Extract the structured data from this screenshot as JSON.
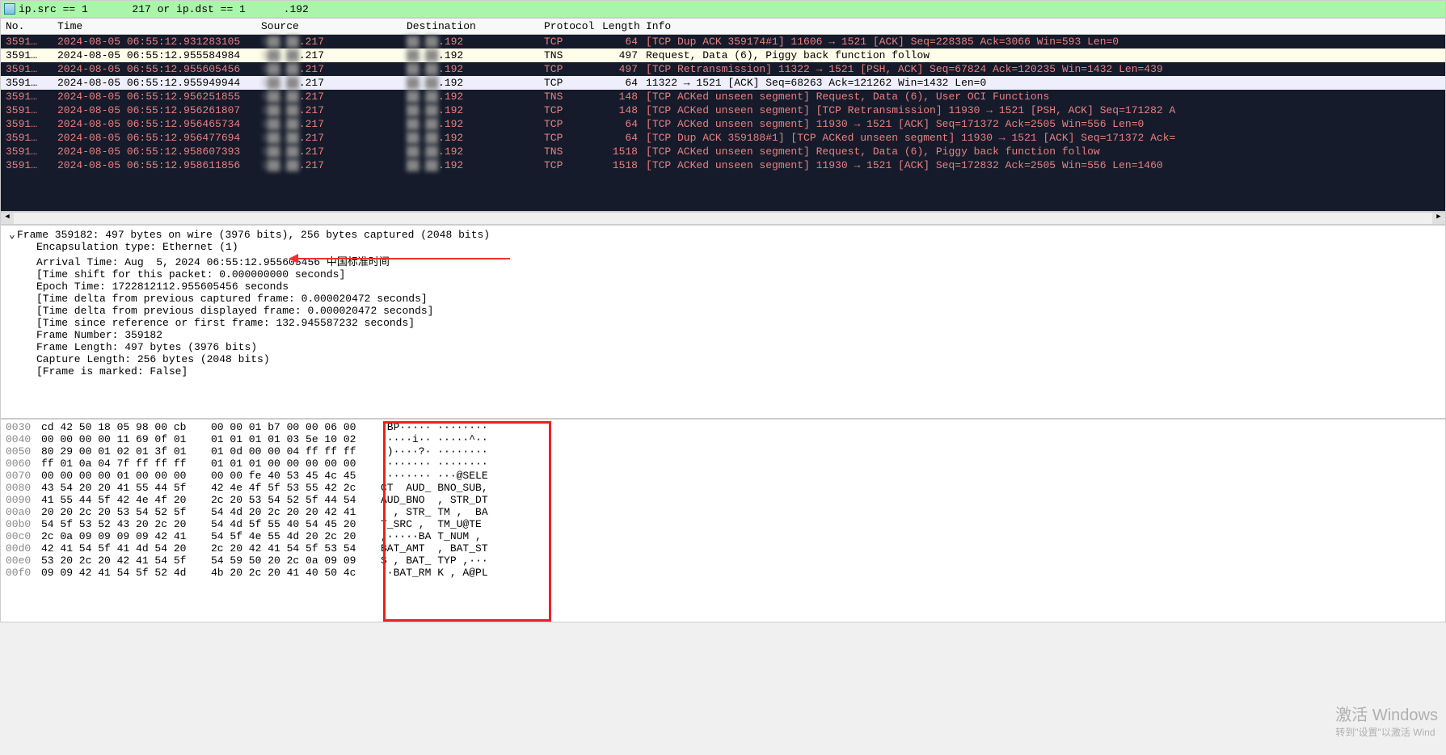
{
  "filter": {
    "value": "ip.src == 1       217 or ip.dst == 1      .192"
  },
  "headers": {
    "no": "No.",
    "time": "Time",
    "src": "Source",
    "dst": "Destination",
    "proto": "Protocol",
    "len": "Length",
    "info": "Info"
  },
  "packets": [
    {
      "style": "dark",
      "no": "3591…",
      "time": "2024-08-05 06:55:12.931283105",
      "src": "███.███.217",
      "dst": "███.███.192",
      "proto": "TCP",
      "len": "64",
      "info": "[TCP Dup ACK 359174#1] 11606 → 1521 [ACK] Seq=228385 Ack=3066 Win=593 Len=0"
    },
    {
      "style": "light",
      "no": "3591…",
      "time": "2024-08-05 06:55:12.955584984",
      "src": "███.███.217",
      "dst": "███.███.192",
      "proto": "TNS",
      "len": "497",
      "info": "Request, Data (6), Piggy back function follow"
    },
    {
      "style": "dark",
      "no": "3591…",
      "time": "2024-08-05 06:55:12.955605456",
      "src": "███.███.217",
      "dst": "███.███.192",
      "proto": "TCP",
      "len": "497",
      "info": "[TCP Retransmission] 11322 → 1521 [PSH, ACK] Seq=67824 Ack=120235 Win=1432 Len=439"
    },
    {
      "style": "light2",
      "no": "3591…",
      "time": "2024-08-05 06:55:12.955949944",
      "src": "███.███.217",
      "dst": "███.███.192",
      "proto": "TCP",
      "len": "64",
      "info": "11322 → 1521 [ACK] Seq=68263 Ack=121262 Win=1432 Len=0"
    },
    {
      "style": "dark",
      "no": "3591…",
      "time": "2024-08-05 06:55:12.956251855",
      "src": "███.███.217",
      "dst": "███.███.192",
      "proto": "TNS",
      "len": "148",
      "info": "[TCP ACKed unseen segment] Request, Data (6), User OCI Functions"
    },
    {
      "style": "dark",
      "no": "3591…",
      "time": "2024-08-05 06:55:12.956261807",
      "src": "███.███.217",
      "dst": "███.███.192",
      "proto": "TCP",
      "len": "148",
      "info": "[TCP ACKed unseen segment] [TCP Retransmission] 11930 → 1521 [PSH, ACK] Seq=171282 A"
    },
    {
      "style": "dark",
      "no": "3591…",
      "time": "2024-08-05 06:55:12.956465734",
      "src": "███.███.217",
      "dst": "███.███.192",
      "proto": "TCP",
      "len": "64",
      "info": "[TCP ACKed unseen segment] 11930 → 1521 [ACK] Seq=171372 Ack=2505 Win=556 Len=0"
    },
    {
      "style": "dark",
      "no": "3591…",
      "time": "2024-08-05 06:55:12.956477694",
      "src": "███.███.217",
      "dst": "███.███.192",
      "proto": "TCP",
      "len": "64",
      "info": "[TCP Dup ACK 359188#1] [TCP ACKed unseen segment] 11930 → 1521 [ACK] Seq=171372 Ack="
    },
    {
      "style": "dark",
      "no": "3591…",
      "time": "2024-08-05 06:55:12.958607393",
      "src": "███.███.217",
      "dst": "███.███.192",
      "proto": "TNS",
      "len": "1518",
      "info": "[TCP ACKed unseen segment] Request, Data (6), Piggy back function follow"
    },
    {
      "style": "dark",
      "no": "3591…",
      "time": "2024-08-05 06:55:12.958611856",
      "src": "███.███.217",
      "dst": "███.███.192",
      "proto": "TCP",
      "len": "1518",
      "info": "[TCP ACKed unseen segment] 11930 → 1521 [ACK] Seq=172832 Ack=2505 Win=556 Len=1460"
    }
  ],
  "details": {
    "frame_header": "Frame 359182: 497 bytes on wire (3976 bits), 256 bytes captured (2048 bits)",
    "lines": [
      "Encapsulation type: Ethernet (1)",
      "Arrival Time: Aug  5, 2024 06:55:12.955605456 中国标准时间",
      "[Time shift for this packet: 0.000000000 seconds]",
      "Epoch Time: 1722812112.955605456 seconds",
      "[Time delta from previous captured frame: 0.000020472 seconds]",
      "[Time delta from previous displayed frame: 0.000020472 seconds]",
      "[Time since reference or first frame: 132.945587232 seconds]",
      "Frame Number: 359182",
      "Frame Length: 497 bytes (3976 bits)",
      "Capture Length: 256 bytes (2048 bits)",
      "[Frame is marked: False]"
    ]
  },
  "hex": [
    {
      "off": "0030",
      "b1": "cd 42 50 18 05 98 00 cb ",
      "b2": "00 00 01 b7 00 00 06 00",
      "a": "·BP····· ········"
    },
    {
      "off": "0040",
      "b1": "00 00 00 00 11 69 0f 01 ",
      "b2": "01 01 01 01 03 5e 10 02",
      "a": "·····i·· ·····^··"
    },
    {
      "off": "0050",
      "b1": "80 29 00 01 02 01 3f 01 ",
      "b2": "01 0d 00 00 04 ff ff ff",
      "a": "·)····?· ········"
    },
    {
      "off": "0060",
      "b1": "ff 01 0a 04 7f ff ff ff ",
      "b2": "01 01 01 00 00 00 00 00",
      "a": "········ ········"
    },
    {
      "off": "0070",
      "b1": "00 00 00 00 01 00 00 00 ",
      "b2": "00 00 fe 40 53 45 4c 45",
      "a": "········ ···@SELE"
    },
    {
      "off": "0080",
      "b1": "43 54 20 20 41 55 44 5f ",
      "b2": "42 4e 4f 5f 53 55 42 2c",
      "a": "CT  AUD_ BNO_SUB,"
    },
    {
      "off": "0090",
      "b1": "41 55 44 5f 42 4e 4f 20 ",
      "b2": "2c 20 53 54 52 5f 44 54",
      "a": "AUD_BNO  , STR_DT"
    },
    {
      "off": "00a0",
      "b1": "20 20 2c 20 53 54 52 5f ",
      "b2": "54 4d 20 2c 20 20 42 41",
      "a": "  , STR_ TM ,  BA"
    },
    {
      "off": "00b0",
      "b1": "54 5f 53 52 43 20 2c 20 ",
      "b2": "54 4d 5f 55 40 54 45 20",
      "a": "T_SRC ,  TM_U@TE "
    },
    {
      "off": "00c0",
      "b1": "2c 0a 09 09 09 09 42 41 ",
      "b2": "54 5f 4e 55 4d 20 2c 20",
      "a": ",·····BA T_NUM , "
    },
    {
      "off": "00d0",
      "b1": "42 41 54 5f 41 4d 54 20 ",
      "b2": "2c 20 42 41 54 5f 53 54",
      "a": "BAT_AMT  , BAT_ST"
    },
    {
      "off": "00e0",
      "b1": "53 20 2c 20 42 41 54 5f ",
      "b2": "54 59 50 20 2c 0a 09 09",
      "a": "S , BAT_ TYP ,···"
    },
    {
      "off": "00f0",
      "b1": "09 09 42 41 54 5f 52 4d ",
      "b2": "4b 20 2c 20 41 40 50 4c",
      "a": "··BAT_RM K , A@PL"
    }
  ],
  "watermark": {
    "line1": "激活 Windows",
    "line2": "转到\"设置\"以激活 Wind"
  }
}
